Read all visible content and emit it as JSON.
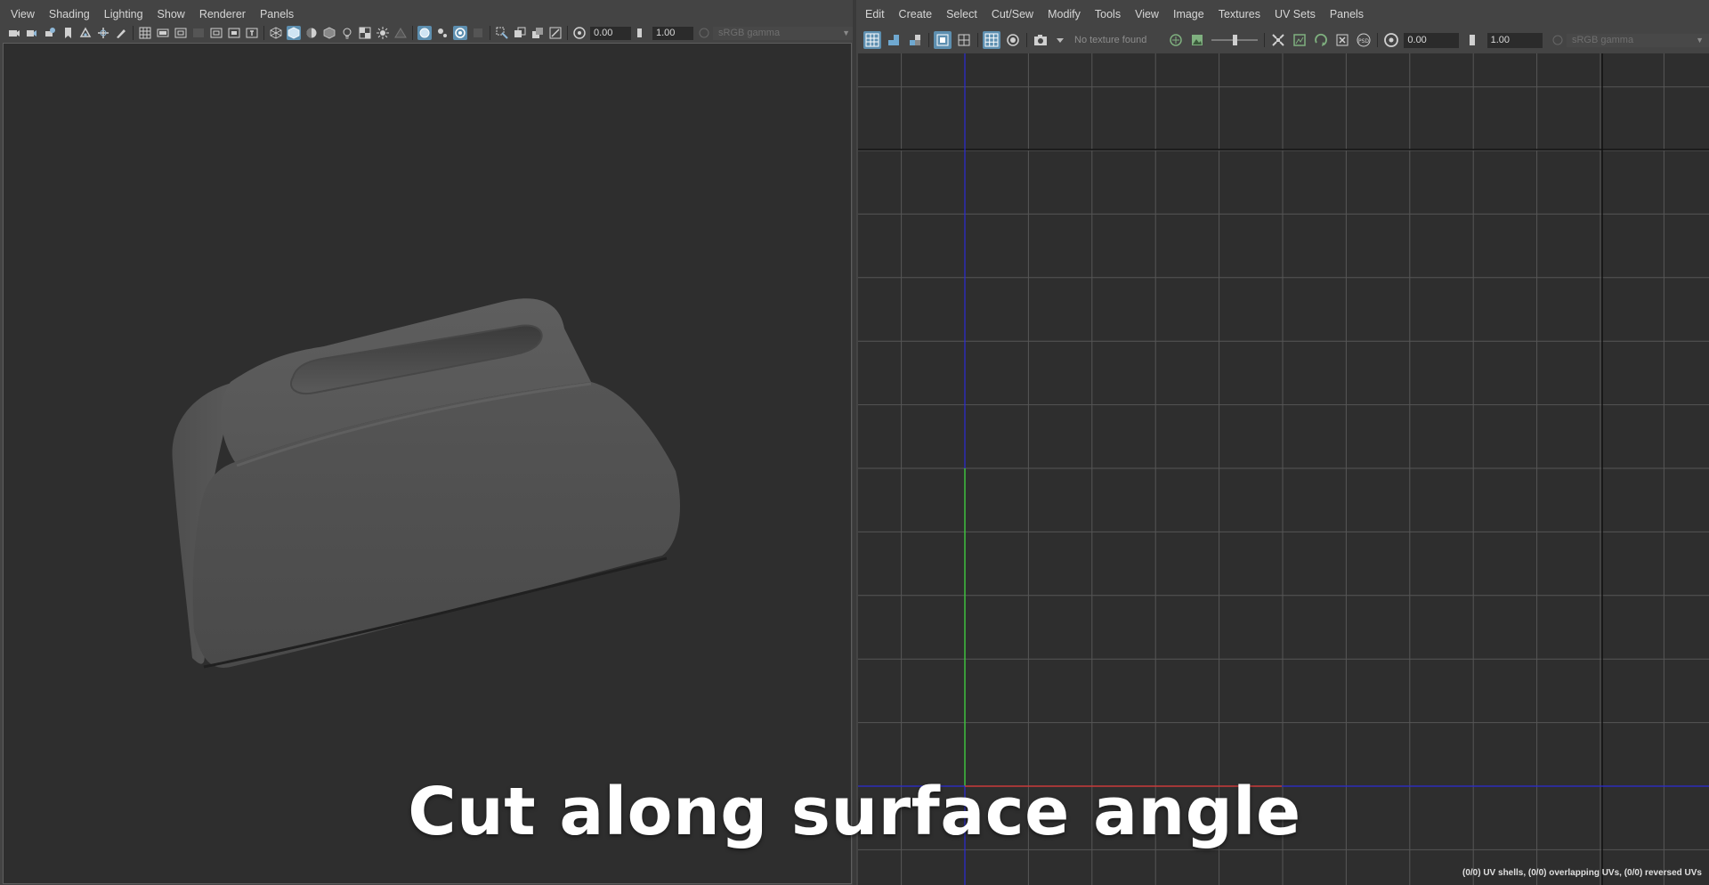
{
  "left_panel": {
    "menu": [
      "View",
      "Shading",
      "Lighting",
      "Show",
      "Renderer",
      "Panels"
    ],
    "exposure_value": "0.00",
    "gamma_value": "1.00",
    "color_space": "sRGB gamma"
  },
  "right_panel": {
    "menu": [
      "Edit",
      "Create",
      "Select",
      "Cut/Sew",
      "Modify",
      "Tools",
      "View",
      "Image",
      "Textures",
      "UV Sets",
      "Panels"
    ],
    "texture_status": "No texture found",
    "exposure_value": "0.00",
    "gamma_value": "1.00",
    "color_space": "sRGB gamma",
    "uv_stats": "(0/0) UV shells, (0/0) overlapping UVs, (0/0) reversed UVs"
  },
  "caption": "Cut along surface angle",
  "colors": {
    "ui_background": "#444444",
    "viewport_background": "#2e2e2e",
    "accent_active": "#5d8fb0",
    "uv_axis_u": "#c83a3a",
    "uv_axis_v": "#3fbf3f",
    "uv_axis_blue": "#2b2bd6",
    "caption_text": "#ffffff"
  },
  "model": {
    "name": "tissue-box",
    "type": "rounded box with slot opening on top"
  }
}
